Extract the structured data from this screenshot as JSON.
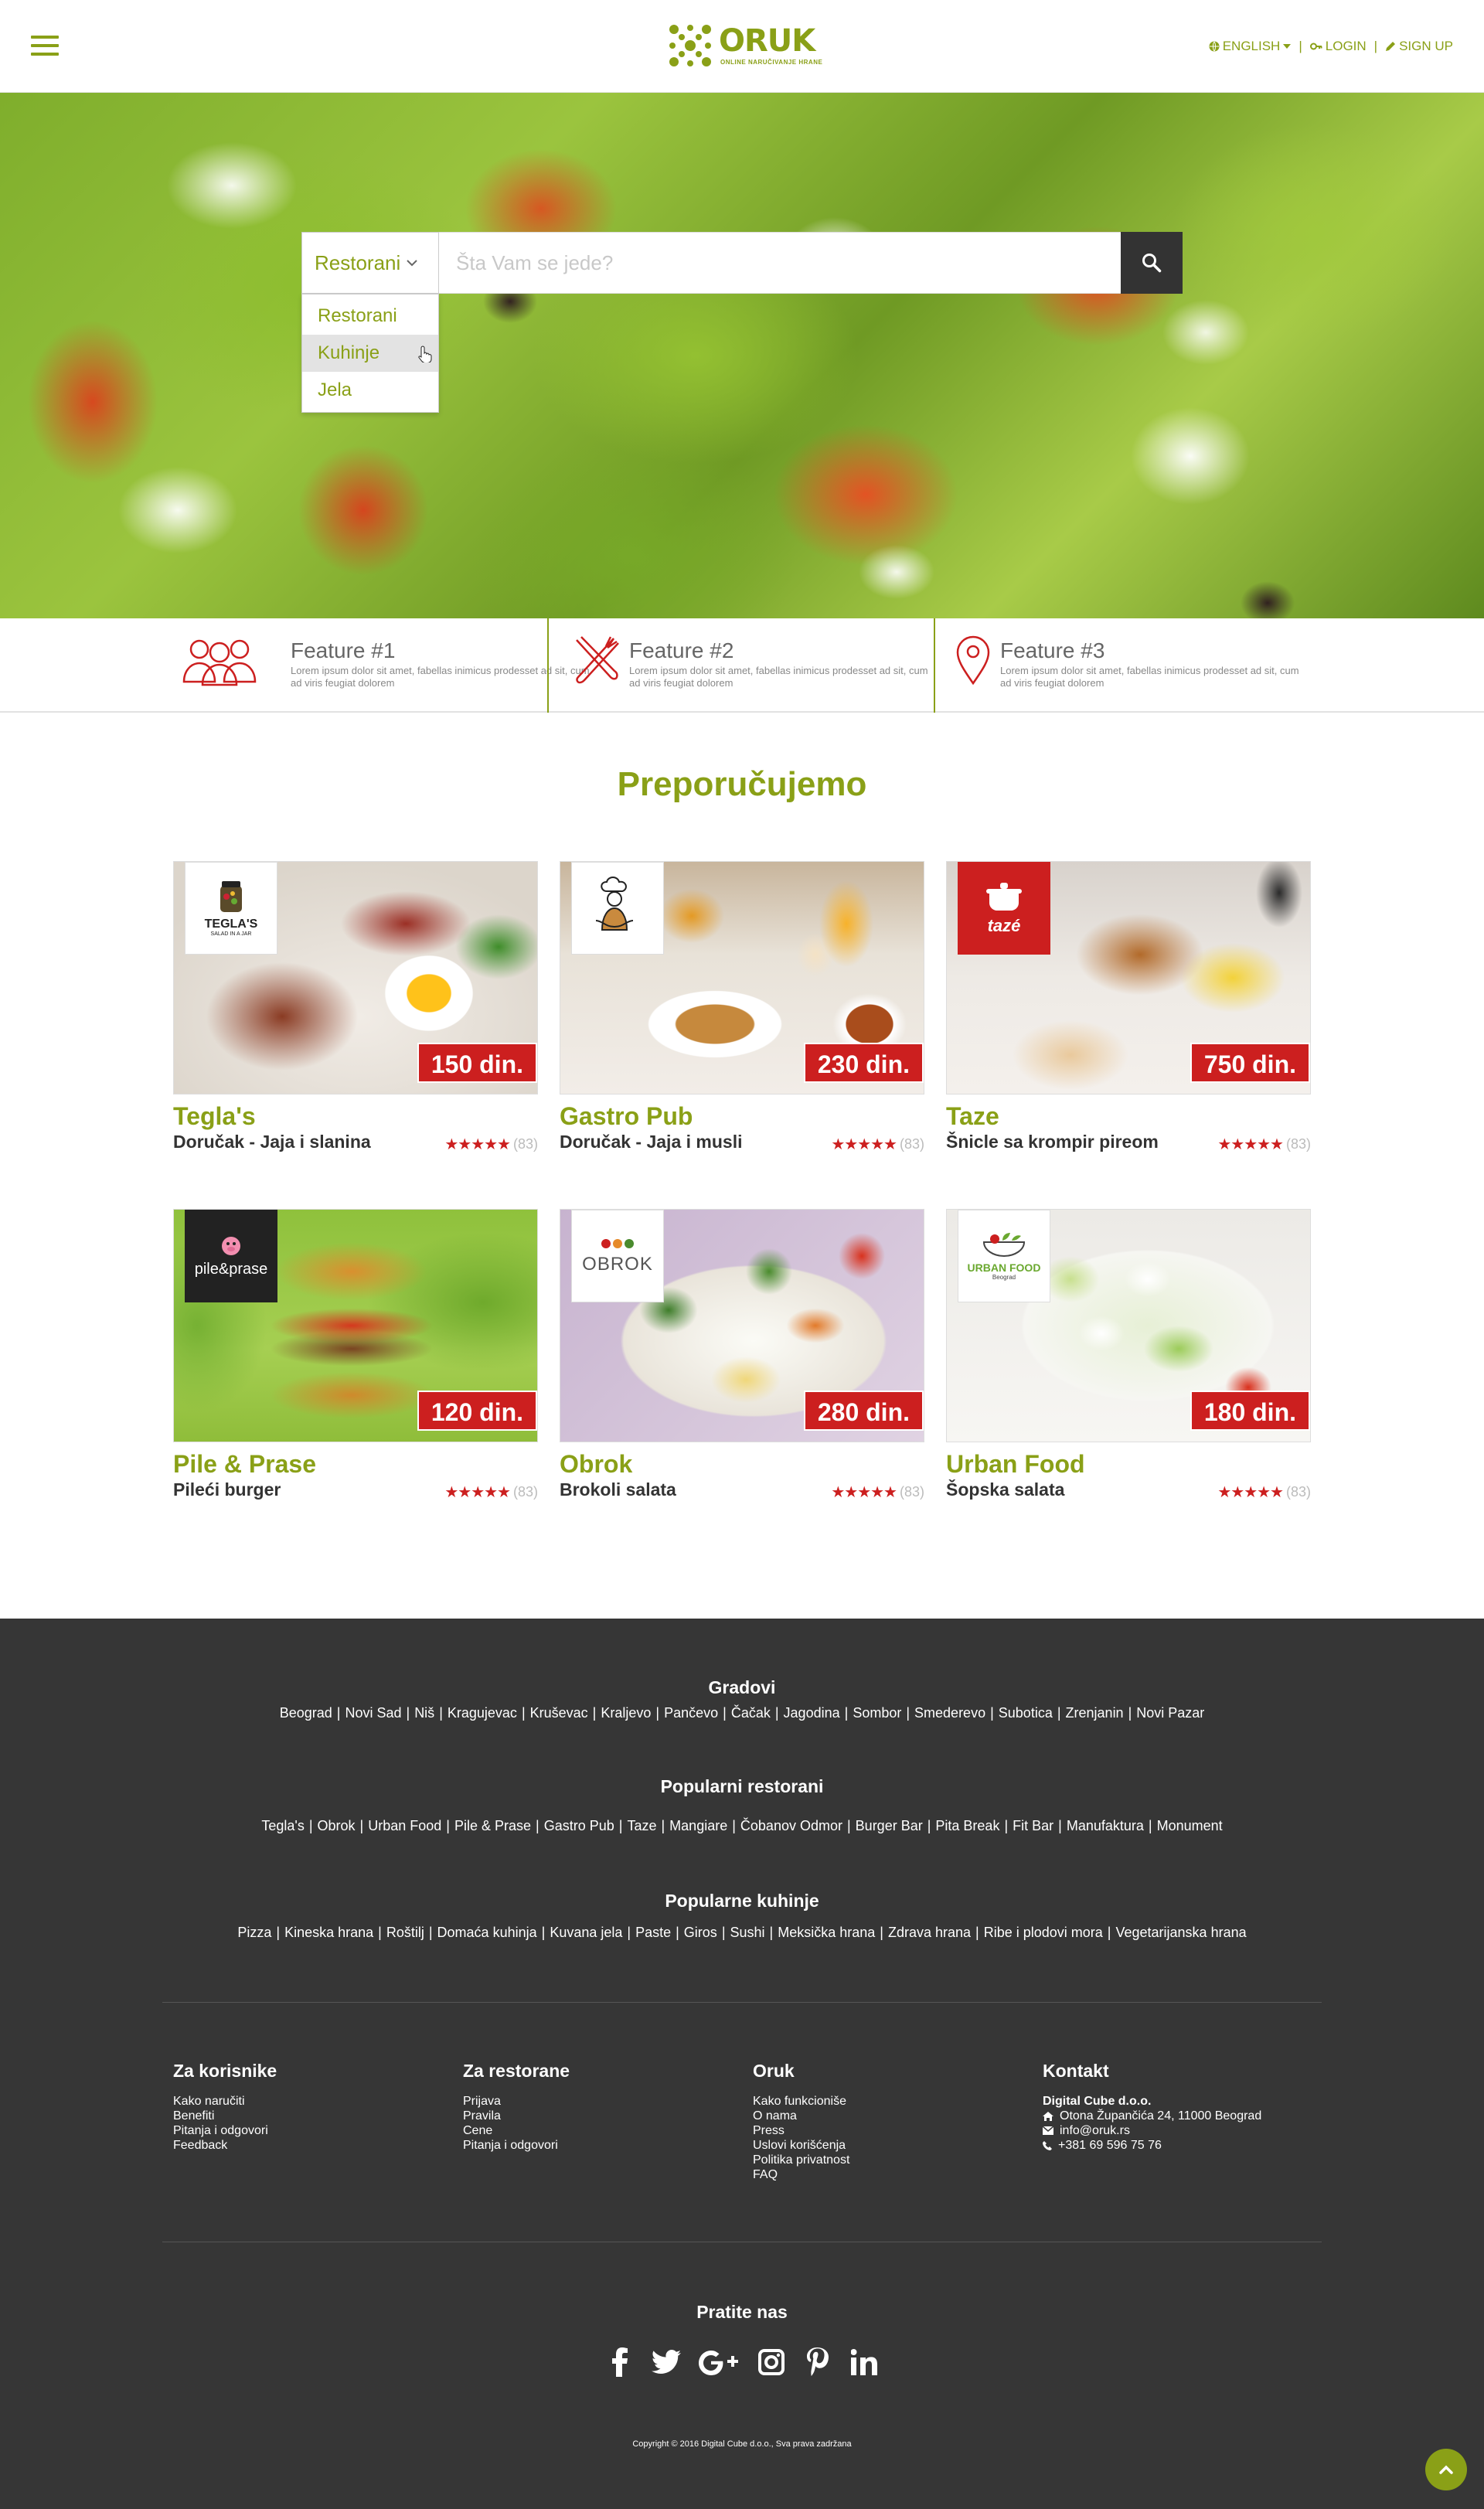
{
  "header": {
    "logo_text": "ORUK",
    "logo_tagline": "ONLINE NARUČIVANJE HRANE",
    "language": "ENGLISH",
    "login": "LOGIN",
    "signup": "SIGN UP",
    "sep": "|"
  },
  "search": {
    "selected": "Restorani",
    "placeholder": "Šta Vam se jede?",
    "options": [
      "Restorani",
      "Kuhinje",
      "Jela"
    ]
  },
  "features": [
    {
      "title": "Feature #1",
      "desc": "Lorem ipsum dolor sit amet, fabellas inimicus prodesset ad sit, cum ad viris feugiat dolorem"
    },
    {
      "title": "Feature #2",
      "desc": "Lorem ipsum dolor sit amet, fabellas inimicus prodesset ad sit, cum ad viris feugiat dolorem"
    },
    {
      "title": "Feature #3",
      "desc": "Lorem ipsum dolor sit amet, fabellas inimicus prodesset ad sit, cum ad viris feugiat dolorem"
    }
  ],
  "recommended": {
    "title": "Preporučujemo",
    "cards": [
      {
        "name": "Tegla's",
        "dish": "Doručak - Jaja i slanina",
        "price": "150 din.",
        "count": "(83)",
        "logo": "TEGLA'S",
        "logo_sub": "SALAD IN A JAR",
        "stars": "★★★★★"
      },
      {
        "name": "Gastro Pub",
        "dish": "Doručak - Jaja i musli",
        "price": "230 din.",
        "count": "(83)",
        "logo": "",
        "logo_sub": "",
        "stars": "★★★★★"
      },
      {
        "name": "Taze",
        "dish": "Šnicle sa krompir pireom",
        "price": "750 din.",
        "count": "(83)",
        "logo": "tazé",
        "logo_sub": "",
        "stars": "★★★★★"
      },
      {
        "name": "Pile & Prase",
        "dish": "Pileći burger",
        "price": "120 din.",
        "count": "(83)",
        "logo": "pile&prase",
        "logo_sub": "",
        "stars": "★★★★★"
      },
      {
        "name": "Obrok",
        "dish": "Brokoli salata",
        "price": "280 din.",
        "count": "(83)",
        "logo": "OBROK",
        "logo_sub": "",
        "stars": "★★★★★"
      },
      {
        "name": "Urban Food",
        "dish": "Šopska salata",
        "price": "180 din.",
        "count": "(83)",
        "logo": "URBAN FOOD",
        "logo_sub": "Beograd",
        "stars": "★★★★★"
      }
    ]
  },
  "footer": {
    "cities_title": "Gradovi",
    "cities": [
      "Beograd",
      "Novi Sad",
      "Niš",
      "Kragujevac",
      "Kruševac",
      "Kraljevo",
      "Pančevo",
      "Čačak",
      "Jagodina",
      "Sombor",
      "Smederevo",
      "Subotica",
      "Zrenjanin",
      "Novi Pazar"
    ],
    "restaurants_title": "Popularni restorani",
    "restaurants": [
      "Tegla's",
      "Obrok",
      "Urban Food",
      "Pile & Prase",
      "Gastro Pub",
      "Taze",
      "Mangiare",
      "Čobanov Odmor",
      "Burger Bar",
      "Pita Break",
      "Fit Bar",
      "Manufaktura",
      "Monument"
    ],
    "cuisines_title": "Popularne kuhinje",
    "cuisines": [
      "Pizza",
      "Kineska hrana",
      "Roštilj",
      "Domaća kuhinja",
      "Kuvana jela",
      "Paste",
      "Giros",
      "Sushi",
      "Meksička hrana",
      "Zdrava hrana",
      "Ribe i plodovi mora",
      "Vegetarijanska hrana"
    ],
    "sep": "|",
    "columns": [
      {
        "title": "Za korisnike",
        "links": [
          "Kako naručiti",
          "Benefiti",
          "Pitanja i odgovori",
          "Feedback"
        ]
      },
      {
        "title": "Za restorane",
        "links": [
          "Prijava",
          "Pravila",
          "Cene",
          "Pitanja i odgovori"
        ]
      },
      {
        "title": "Oruk",
        "links": [
          "Kako funkcioniše",
          "O nama",
          "Press",
          "Uslovi korišćenja",
          "Politika privatnost",
          "FAQ"
        ]
      }
    ],
    "contact": {
      "title": "Kontakt",
      "company": "Digital Cube d.o.o.",
      "address": "Otona Župančića  24, 11000 Beograd",
      "email": "info@oruk.rs",
      "phone": "+381 69 596 75 76"
    },
    "follow_title": "Pratite nas",
    "social": [
      "facebook-icon",
      "twitter-icon",
      "google-plus-icon",
      "instagram-icon",
      "pinterest-icon",
      "linkedin-icon"
    ],
    "copyright": "Copyright © 2016 Digital Cube d.o.o., Sva prava zadržana"
  },
  "colors": {
    "brand": "#8aa017",
    "price": "#cc1f1f",
    "footer": "#363636"
  }
}
